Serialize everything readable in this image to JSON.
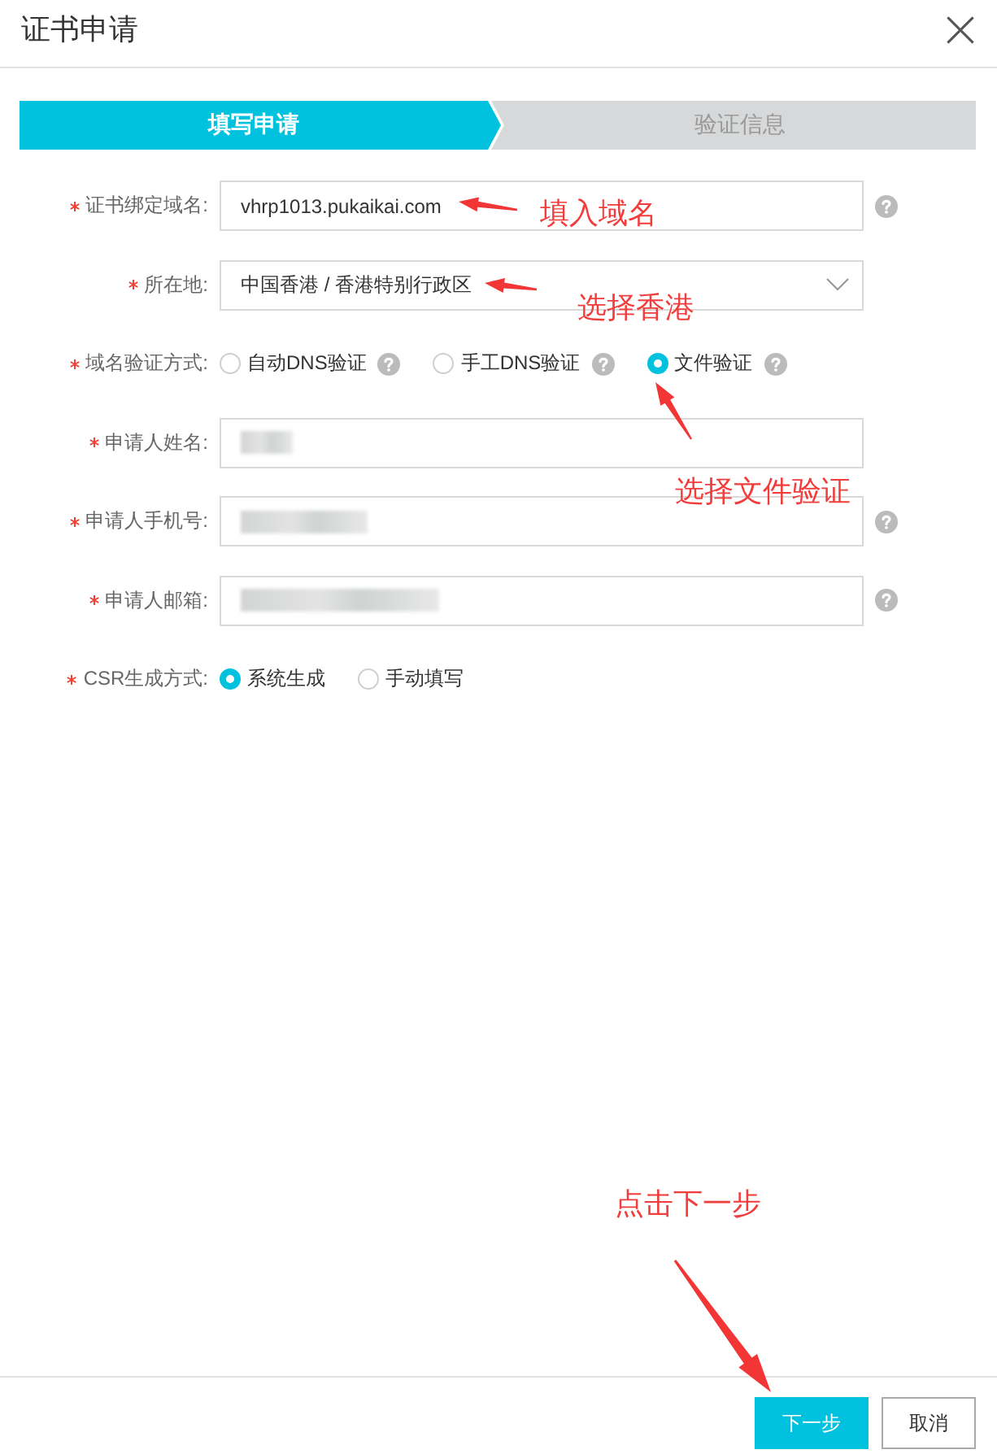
{
  "dialog": {
    "title": "证书申请"
  },
  "steps": [
    {
      "label": "填写申请",
      "selected": true
    },
    {
      "label": "验证信息",
      "selected": false
    }
  ],
  "form": {
    "fields": [
      {
        "kind": "text",
        "required": true,
        "label": "证书绑定域名:",
        "value": "vhrp1013.pukaikai.com",
        "help": true
      },
      {
        "kind": "select",
        "required": true,
        "label": "所在地:",
        "value": "中国香港 / 香港特别行政区"
      },
      {
        "kind": "radio",
        "required": true,
        "label": "域名验证方式:",
        "options": [
          {
            "label": "自动DNS验证",
            "selected": false,
            "help": true
          },
          {
            "label": "手工DNS验证",
            "selected": false,
            "help": true
          },
          {
            "label": "文件验证",
            "selected": true,
            "help": true
          }
        ]
      },
      {
        "kind": "redacted",
        "required": true,
        "label": "申请人姓名:"
      },
      {
        "kind": "redacted",
        "required": true,
        "label": "申请人手机号:",
        "help": true
      },
      {
        "kind": "redacted",
        "required": true,
        "label": "申请人邮箱:",
        "help": true
      },
      {
        "kind": "radio",
        "required": true,
        "label": "CSR生成方式:",
        "options": [
          {
            "label": "系统生成",
            "selected": true
          },
          {
            "label": "手动填写",
            "selected": false
          }
        ]
      }
    ]
  },
  "footer": {
    "buttons": [
      {
        "kind": "primary",
        "label": "下一步"
      },
      {
        "kind": "default",
        "label": "取消"
      }
    ]
  },
  "annotations": [
    {
      "text": "填入域名"
    },
    {
      "text": "选择香港"
    },
    {
      "text": "选择文件验证"
    },
    {
      "text": "点击下一步"
    }
  ]
}
